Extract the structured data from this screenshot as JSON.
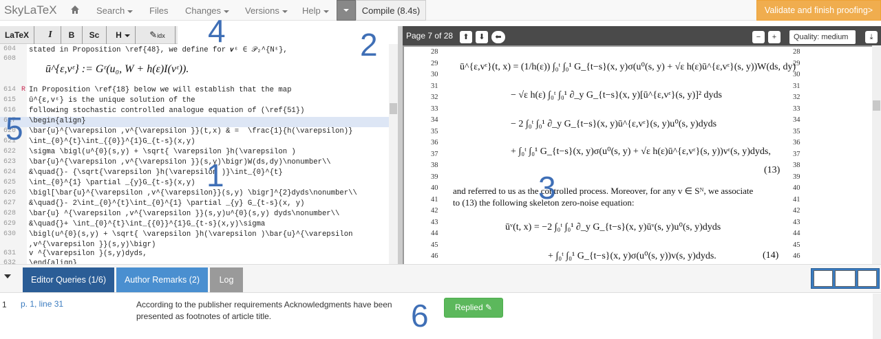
{
  "nav": {
    "brand": "SkyLaTeX",
    "home_icon": "home-icon",
    "search": "Search",
    "files": "Files",
    "changes": "Changes",
    "versions": "Versions",
    "help": "Help",
    "compile": "Compile (8.4s)",
    "validate": "Validate and finish proofing>"
  },
  "editor_toolbar": {
    "latex": "LaTeX",
    "italic": "I",
    "bold": "B",
    "smallcaps": "Sc",
    "heading": "H",
    "idx": "idx"
  },
  "editor": {
    "math_display": "ū^{ε,vᵋ} := Gᵋ(u₀, W + h(ε)I(vᵋ)).",
    "lines": [
      {
        "n": "604",
        "m": "",
        "t": "stated in Proposition \\ref{48}, we define for 𝒗ᵋ ∈ 𝒫₂^{Nᵋ},"
      },
      {
        "n": "608",
        "m": "",
        "t": ""
      },
      {
        "n": "614",
        "m": "R",
        "t": "In Proposition \\ref{18} below we will establish that the map"
      },
      {
        "n": "615",
        "m": "",
        "t": "ū^{ε,vᵋ} is the unique solution of the"
      },
      {
        "n": "616",
        "m": "",
        "t": "following stochastic controlled analogue equation of (\\ref{51})"
      },
      {
        "n": "617",
        "m": "",
        "t": "\\begin{align}"
      },
      {
        "n": "620",
        "m": "",
        "t": "\\bar{u}^{\\varepsilon ,v^{\\varepsilon }}(t,x) & =  \\frac{1}{h(\\varepsilon)}"
      },
      {
        "n": "621",
        "m": "",
        "t": "\\int_{0}^{t}\\int_{{0}}^{1}G_{t-s}(x,y)"
      },
      {
        "n": "622",
        "m": "",
        "t": "\\sigma \\bigl(u^{0}(s,y) + \\sqrt{ \\varepsilon }h(\\varepsilon )"
      },
      {
        "n": "623",
        "m": "",
        "t": "\\bar{u}^{\\varepsilon ,v^{\\varepsilon }}(s,y)\\bigr)W(ds,dy)\\nonumber\\\\"
      },
      {
        "n": "624",
        "m": "",
        "t": "&\\quad{}- {\\sqrt{\\varepsilon }h(\\varepsilon )}\\int_{0}^{t}"
      },
      {
        "n": "625",
        "m": "",
        "t": "\\int_{0}^{1} \\partial _{y}G_{t-s}(x,y)"
      },
      {
        "n": "626",
        "m": "",
        "t": "\\bigl[\\bar{u}^{\\varepsilon ,v^{\\varepsilon}}(s,y) \\bigr]^{2}dyds\\nonumber\\\\"
      },
      {
        "n": "627",
        "m": "",
        "t": "&\\quad{}- 2\\int_{0}^{t}\\int_{0}^{1} \\partial _{y} G_{t-s}(x, y)"
      },
      {
        "n": "628",
        "m": "",
        "t": "\\bar{u} ^{\\varepsilon ,v^{\\varepsilon }}(s,y)u^{0}(s,y) dyds\\nonumber\\\\"
      },
      {
        "n": "629",
        "m": "",
        "t": "&\\quad{}+ \\int_{0}^{t}\\int_{{0}}^{1}G_{t-s}(x,y)\\sigma"
      },
      {
        "n": "630",
        "m": "",
        "t": "\\bigl(u^{0}(s,y) + \\sqrt{ \\varepsilon }h(\\varepsilon )\\bar{u}^{\\varepsilon"
      },
      {
        "n": "",
        "m": "",
        "t": ",v^{\\varepsilon }}(s,y)\\bigr)"
      },
      {
        "n": "631",
        "m": "",
        "t": "v ^{\\varepsilon }(s,y)dyds,"
      },
      {
        "n": "632",
        "m": "",
        "t": "\\end{align}"
      }
    ]
  },
  "pdf": {
    "page_info": "Page 7 of 28",
    "quality": "Quality: medium",
    "line_numbers": [
      "28",
      "29",
      "30",
      "31",
      "32",
      "33",
      "34",
      "35",
      "36",
      "37",
      "38",
      "39",
      "40",
      "41",
      "42",
      "43",
      "44",
      "45",
      "46"
    ],
    "eq1": "ū^{ε,vᵋ}(t, x) = (1/h(ε)) ∫₀ᵗ ∫₀¹ G_{t−s}(x, y)σ(u⁰(s, y) + √ε h(ε)ū^{ε,vᵋ}(s, y))W(ds, dy)",
    "eq2": "− √ε h(ε) ∫₀ᵗ ∫₀¹ ∂_y G_{t−s}(x, y)[ū^{ε,vᵋ}(s, y)]² dyds",
    "eq3": "− 2 ∫₀ᵗ ∫₀¹ ∂_y G_{t−s}(x, y)ū^{ε,vᵋ}(s, y)u⁰(s, y)dyds",
    "eq4": "+ ∫₀ᵗ ∫₀¹ G_{t−s}(x, y)σ(u⁰(s, y) + √ε h(ε)ū^{ε,vᵋ}(s, y))vᵋ(s, y)dyds,",
    "eqno1": "(13)",
    "para1": "and referred to us as the controlled process. Moreover, for any v ∈ Sᴺ, we associate",
    "para2": "to (13) the following skeleton zero-noise equation:",
    "eq5": "ūᵛ(t, x) = −2 ∫₀ᵗ ∫₀¹ ∂_y G_{t−s}(x, y)ūᵛ(s, y)u⁰(s, y)dyds",
    "eq6": "+ ∫₀ᵗ ∫₀¹ G_{t−s}(x, y)σ(u⁰(s, y))v(s, y)dyds.",
    "eqno2": "(14)"
  },
  "bottom": {
    "tabs": [
      "Editor Queries (1/6)",
      "Author Remarks (2)",
      "Log"
    ],
    "query_num": "1",
    "query_ref": "p. 1, line 31",
    "query_text": "According to the publisher requirements Acknowledgments have been presented as footnotes of article title.",
    "replied": "Replied"
  },
  "annotations": [
    "1",
    "2",
    "3",
    "4",
    "5",
    "6"
  ],
  "colors": {
    "accent": "#3a7bbf",
    "tab_active": "#2b5d96",
    "tab_inactive": "#4a8fd0",
    "tab_log": "#9a9a9a",
    "validate": "#f0ad4e",
    "replied": "#5cb85c"
  }
}
